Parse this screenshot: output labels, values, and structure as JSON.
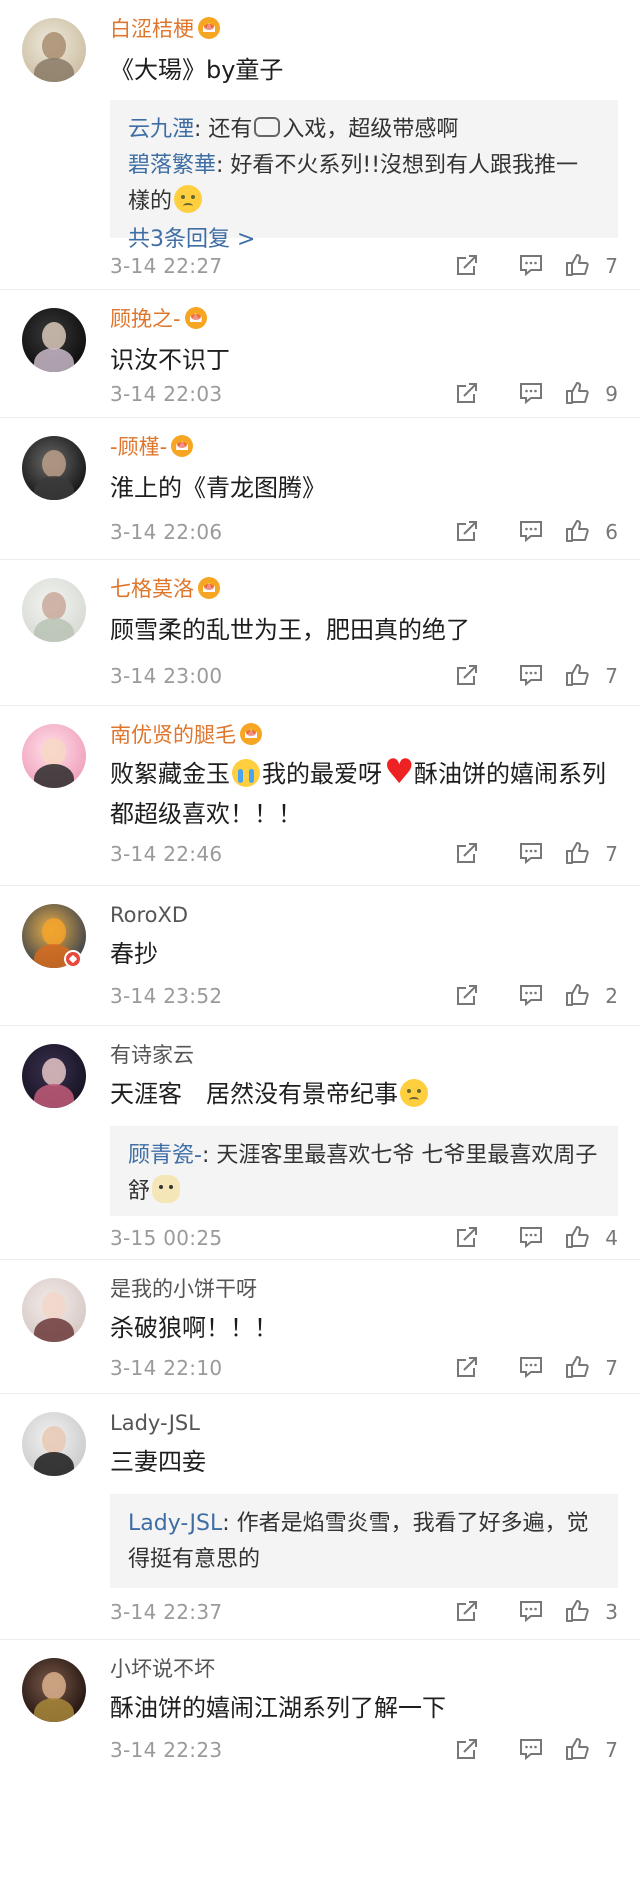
{
  "comments": [
    {
      "username": "白涩桔梗",
      "vip": true,
      "text_parts": [
        "《大瑒》by童子"
      ],
      "replies": [
        {
          "name": "云九湮",
          "text_parts": [
            ": 还有",
            "入戏，超级带感啊"
          ]
        },
        {
          "name": "碧落繁華",
          "text_parts": [
            ": 好看不火系列!!沒想到有人跟我推一樣的"
          ]
        }
      ],
      "more_replies": "共3条回复 >",
      "time": "3-14 22:27",
      "likes": "7"
    },
    {
      "username": "顾挽之-",
      "vip": true,
      "text_parts": [
        "识汝不识丁"
      ],
      "time": "3-14 22:03",
      "likes": "9"
    },
    {
      "username": "-顾槿-",
      "vip": true,
      "text_parts": [
        "淮上的《青龙图腾》"
      ],
      "time": "3-14 22:06",
      "likes": "6"
    },
    {
      "username": "七格莫洛",
      "vip": true,
      "text_parts": [
        "顾雪柔的乱世为王，肥田真的绝了"
      ],
      "time": "3-14 23:00",
      "likes": "7"
    },
    {
      "username": "南优贤的腿毛",
      "vip": true,
      "text_parts": [
        "败絮藏金玉",
        "我的最爱呀",
        "酥油饼的嬉闹系列都超级喜欢！！！"
      ],
      "time": "3-14 22:46",
      "likes": "7"
    },
    {
      "username": "RoroXD",
      "vip": false,
      "text_parts": [
        "春抄"
      ],
      "time": "3-14 23:52",
      "likes": "2"
    },
    {
      "username": "有诗家云",
      "vip": false,
      "text_parts": [
        "天涯客　居然没有景帝纪事"
      ],
      "replies": [
        {
          "name": "顾青瓷-",
          "text_parts": [
            ": 天涯客里最喜欢七爷 七爷里最喜欢周子舒"
          ]
        }
      ],
      "time": "3-15 00:25",
      "likes": "4"
    },
    {
      "username": "是我的小饼干呀",
      "vip": false,
      "text_parts": [
        "杀破狼啊！！！"
      ],
      "time": "3-14 22:10",
      "likes": "7"
    },
    {
      "username": "Lady-JSL",
      "vip": false,
      "text_parts": [
        "三妻四妾"
      ],
      "replies": [
        {
          "name": "Lady-JSL",
          "text_parts": [
            ": 作者是焰雪炎雪，我看了好多遍，觉得挺有意思的"
          ]
        }
      ],
      "time": "3-14 22:37",
      "likes": "3"
    },
    {
      "username": "小坏说不坏",
      "vip": false,
      "text_parts": [
        "酥油饼的嬉闹江湖系列了解一下"
      ],
      "time": "3-14 22:23",
      "likes": "7"
    }
  ],
  "icons": {
    "share": "share-icon",
    "reply": "comment-icon",
    "like": "thumbs-up-icon",
    "vip": "crown-badge-icon"
  },
  "colors": {
    "vip_name": "#e0762c",
    "reply_name": "#3f6ea5",
    "meta": "#9a9a9a"
  }
}
